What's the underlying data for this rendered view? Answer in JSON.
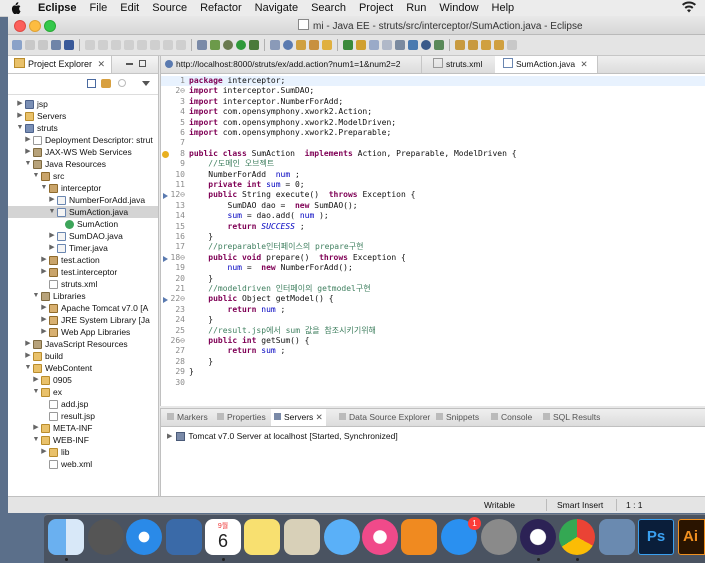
{
  "menubar": {
    "app": "Eclipse",
    "items": [
      "File",
      "Edit",
      "Source",
      "Refactor",
      "Navigate",
      "Search",
      "Project",
      "Run",
      "Window",
      "Help"
    ]
  },
  "window": {
    "title": "mi - Java EE - struts/src/interceptor/SumAction.java - Eclipse"
  },
  "project_explorer": {
    "title": "Project Explorer",
    "close_symbol": "✕",
    "tree": [
      {
        "label": "jsp",
        "depth": 0,
        "twisty": "▶",
        "icon": "proj"
      },
      {
        "label": "Servers",
        "depth": 0,
        "twisty": "▶",
        "icon": "folder"
      },
      {
        "label": "struts",
        "depth": 0,
        "twisty": "▼",
        "icon": "proj"
      },
      {
        "label": "Deployment Descriptor: strut",
        "depth": 1,
        "twisty": "▶",
        "icon": "xml"
      },
      {
        "label": "JAX-WS Web Services",
        "depth": 1,
        "twisty": "▶",
        "icon": "lib"
      },
      {
        "label": "Java Resources",
        "depth": 1,
        "twisty": "▼",
        "icon": "lib"
      },
      {
        "label": "src",
        "depth": 2,
        "twisty": "▼",
        "icon": "pkg"
      },
      {
        "label": "interceptor",
        "depth": 3,
        "twisty": "▼",
        "icon": "pkg"
      },
      {
        "label": "NumberForAdd.java",
        "depth": 4,
        "twisty": "▶",
        "icon": "java"
      },
      {
        "label": "SumAction.java",
        "depth": 4,
        "twisty": "▼",
        "icon": "java",
        "selected": true
      },
      {
        "label": "SumAction",
        "depth": 5,
        "twisty": "",
        "icon": "cls"
      },
      {
        "label": "SumDAO.java",
        "depth": 4,
        "twisty": "▶",
        "icon": "java"
      },
      {
        "label": "Timer.java",
        "depth": 4,
        "twisty": "▶",
        "icon": "java"
      },
      {
        "label": "test.action",
        "depth": 3,
        "twisty": "▶",
        "icon": "pkg"
      },
      {
        "label": "test.interceptor",
        "depth": 3,
        "twisty": "▶",
        "icon": "pkg"
      },
      {
        "label": "struts.xml",
        "depth": 3,
        "twisty": "",
        "icon": "xml"
      },
      {
        "label": "Libraries",
        "depth": 2,
        "twisty": "▼",
        "icon": "lib"
      },
      {
        "label": "Apache Tomcat v7.0 [A",
        "depth": 3,
        "twisty": "▶",
        "icon": "jar"
      },
      {
        "label": "JRE System Library [Ja",
        "depth": 3,
        "twisty": "▶",
        "icon": "jar"
      },
      {
        "label": "Web App Libraries",
        "depth": 3,
        "twisty": "▶",
        "icon": "jar"
      },
      {
        "label": "JavaScript Resources",
        "depth": 1,
        "twisty": "▶",
        "icon": "lib"
      },
      {
        "label": "build",
        "depth": 1,
        "twisty": "▶",
        "icon": "folder"
      },
      {
        "label": "WebContent",
        "depth": 1,
        "twisty": "▼",
        "icon": "folder"
      },
      {
        "label": "0905",
        "depth": 2,
        "twisty": "▶",
        "icon": "folder"
      },
      {
        "label": "ex",
        "depth": 2,
        "twisty": "▼",
        "icon": "folder"
      },
      {
        "label": "add.jsp",
        "depth": 3,
        "twisty": "",
        "icon": "xml"
      },
      {
        "label": "result.jsp",
        "depth": 3,
        "twisty": "",
        "icon": "xml"
      },
      {
        "label": "META-INF",
        "depth": 2,
        "twisty": "▶",
        "icon": "folder"
      },
      {
        "label": "WEB-INF",
        "depth": 2,
        "twisty": "▼",
        "icon": "folder"
      },
      {
        "label": "lib",
        "depth": 3,
        "twisty": "▶",
        "icon": "folder"
      },
      {
        "label": "web.xml",
        "depth": 3,
        "twisty": "",
        "icon": "xml"
      }
    ]
  },
  "editor": {
    "tabs": [
      {
        "label": "http://localhost:8000/struts/ex/add.action?num1=1&num2=2",
        "active": false
      },
      {
        "label": "struts.xml",
        "active": false
      },
      {
        "label": "SumAction.java",
        "active": true,
        "close": "✕"
      }
    ],
    "lines": [
      {
        "n": "1",
        "marker": "",
        "t": [
          [
            "kw",
            "package"
          ],
          [
            "",
            "interceptor;"
          ]
        ]
      },
      {
        "n": "2⊖",
        "marker": "",
        "t": [
          [
            "kw",
            "import"
          ],
          [
            "",
            "interceptor.SumDAO;"
          ]
        ]
      },
      {
        "n": "3",
        "marker": "",
        "t": [
          [
            "kw",
            "import"
          ],
          [
            "",
            "interceptor.NumberForAdd;"
          ]
        ]
      },
      {
        "n": "4",
        "marker": "",
        "t": [
          [
            "kw",
            "import"
          ],
          [
            "",
            "com.opensymphony.xwork2.Action;"
          ]
        ]
      },
      {
        "n": "5",
        "marker": "",
        "t": [
          [
            "kw",
            "import"
          ],
          [
            "",
            "com.opensymphony.xwork2.ModelDriven;"
          ]
        ]
      },
      {
        "n": "6",
        "marker": "",
        "t": [
          [
            "kw",
            "import"
          ],
          [
            "",
            "com.opensymphony.xwork2.Preparable;"
          ]
        ]
      },
      {
        "n": "7",
        "marker": "",
        "t": []
      },
      {
        "n": "8",
        "marker": "warn",
        "t": [
          [
            "kw",
            "public class"
          ],
          [
            "",
            "SumAction "
          ],
          [
            "kw",
            "implements"
          ],
          [
            "",
            "Action, Preparable, ModelDriven {"
          ]
        ]
      },
      {
        "n": "9",
        "marker": "",
        "t": [
          [
            "cm",
            "    //도메인 오브젝트"
          ]
        ]
      },
      {
        "n": "10",
        "marker": "",
        "t": [
          [
            "",
            "    NumberForAdd "
          ],
          [
            "fld",
            "num"
          ],
          [
            "",
            ";"
          ]
        ]
      },
      {
        "n": "11",
        "marker": "",
        "t": [
          [
            "kw",
            "    private int"
          ],
          [
            "fld",
            "sum"
          ],
          [
            "",
            "= 0;"
          ]
        ]
      },
      {
        "n": "12⊖",
        "marker": "tri",
        "t": [
          [
            "kw",
            "    public"
          ],
          [
            "",
            "String execute() "
          ],
          [
            "kw",
            "throws"
          ],
          [
            "",
            "Exception {"
          ]
        ]
      },
      {
        "n": "13",
        "marker": "",
        "t": [
          [
            "",
            "        SumDAO dao = "
          ],
          [
            "kw",
            "new"
          ],
          [
            "",
            "SumDAO();"
          ]
        ]
      },
      {
        "n": "14",
        "marker": "",
        "t": [
          [
            "fld",
            "        sum"
          ],
          [
            "",
            "= dao.add("
          ],
          [
            "fld",
            "num"
          ],
          [
            "",
            ");"
          ]
        ]
      },
      {
        "n": "15",
        "marker": "",
        "t": [
          [
            "kw",
            "        return"
          ],
          [
            "ital",
            "SUCCESS"
          ],
          [
            "",
            ";"
          ]
        ]
      },
      {
        "n": "16",
        "marker": "",
        "t": [
          [
            "",
            "    }"
          ]
        ]
      },
      {
        "n": "17",
        "marker": "",
        "t": [
          [
            "cm",
            "    //preparable인터페이스의 prepare구현"
          ]
        ]
      },
      {
        "n": "18⊖",
        "marker": "tri",
        "t": [
          [
            "kw",
            "    public void"
          ],
          [
            "",
            "prepare() "
          ],
          [
            "kw",
            "throws"
          ],
          [
            "",
            "Exception {"
          ]
        ]
      },
      {
        "n": "19",
        "marker": "",
        "t": [
          [
            "fld",
            "        num"
          ],
          [
            "",
            "= "
          ],
          [
            "kw",
            "new"
          ],
          [
            "",
            "NumberForAdd();"
          ]
        ]
      },
      {
        "n": "20",
        "marker": "",
        "t": [
          [
            "",
            "    }"
          ]
        ]
      },
      {
        "n": "21",
        "marker": "",
        "t": [
          [
            "cm",
            "    //modeldriven 인터페이의 getmodel구현"
          ]
        ]
      },
      {
        "n": "22⊖",
        "marker": "tri",
        "t": [
          [
            "kw",
            "    public"
          ],
          [
            "",
            "Object getModel() {"
          ]
        ]
      },
      {
        "n": "23",
        "marker": "",
        "t": [
          [
            "kw",
            "        return"
          ],
          [
            "fld",
            "num"
          ],
          [
            "",
            ";"
          ]
        ]
      },
      {
        "n": "24",
        "marker": "",
        "t": [
          [
            "",
            "    }"
          ]
        ]
      },
      {
        "n": "25",
        "marker": "",
        "t": [
          [
            "cm",
            "    //result.jsp에서 sum 값을 참조시키기위해"
          ]
        ]
      },
      {
        "n": "26⊖",
        "marker": "",
        "t": [
          [
            "kw",
            "    public int"
          ],
          [
            "",
            "getSum() {"
          ]
        ]
      },
      {
        "n": "27",
        "marker": "",
        "t": [
          [
            "kw",
            "        return"
          ],
          [
            "fld",
            "sum"
          ],
          [
            "",
            ";"
          ]
        ]
      },
      {
        "n": "28",
        "marker": "",
        "t": [
          [
            "",
            "    }"
          ]
        ]
      },
      {
        "n": "29",
        "marker": "",
        "t": [
          [
            "",
            "}"
          ]
        ]
      },
      {
        "n": "30",
        "marker": "",
        "t": []
      }
    ]
  },
  "bottom_panel": {
    "tabs": [
      "Markers",
      "Properties",
      "Servers",
      "Data Source Explorer",
      "Snippets",
      "Console",
      "SQL Results"
    ],
    "active_tab": "Servers",
    "server_row": "Tomcat v7.0 Server at localhost  [Started, Synchronized]"
  },
  "statusbar": {
    "writable": "Writable",
    "insert_mode": "Smart Insert",
    "position": "1 : 1"
  },
  "dock": {
    "calendar_month": "9월",
    "calendar_day": "6",
    "appstore_badge": "1",
    "apps": [
      "finder-icon",
      "launchpad-icon",
      "safari-icon",
      "mail-bird-icon",
      "calendar-icon",
      "notes-icon",
      "photos-preview-icon",
      "messages-icon",
      "music-icon",
      "books-icon",
      "app-store-icon",
      "system-preferences-icon",
      "eclipse-icon",
      "chrome-icon",
      "image-preview-icon",
      "photoshop-icon",
      "illustrator-icon"
    ],
    "photoshop_label": "Ps",
    "illustrator_label": "Ai"
  }
}
